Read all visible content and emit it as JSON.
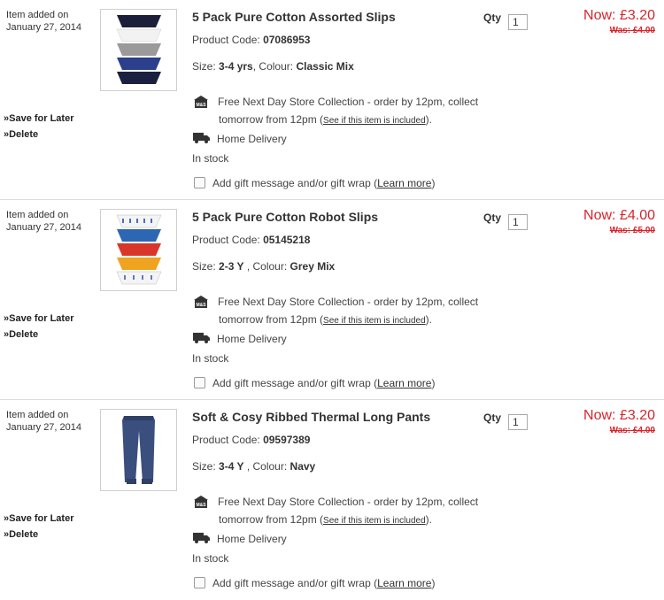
{
  "colors": {
    "price_red": "#d8232a",
    "separator": "#dcdcdc"
  },
  "items": [
    {
      "added_label": "Item added on",
      "added_date": "January 27, 2014",
      "save_label": "»Save for Later",
      "delete_label": "»Delete",
      "title": "5 Pack Pure Cotton Assorted Slips",
      "code_label": "Product Code:",
      "code": "07086953",
      "size_label": "Size:",
      "size": "3-4 yrs",
      "colour_label": ", Colour:",
      "colour": "Classic Mix",
      "collect_text1": "Free Next Day Store Collection - order by 12pm, collect",
      "collect_text2": "tomorrow from 12pm (",
      "collect_link": "See if this item is included",
      "collect_text3": ").",
      "delivery": "Home Delivery",
      "stock": "In stock",
      "gift_text": "Add gift message and/or gift wrap (",
      "gift_link": "Learn more",
      "gift_close": ")",
      "qty_label": "Qty",
      "qty": "1",
      "now_label": "Now:",
      "now_price": "£3.20",
      "was": "Was: £4.00",
      "image_icon": "slips-navy-image"
    },
    {
      "added_label": "Item added on",
      "added_date": "January 27, 2014",
      "save_label": "»Save for Later",
      "delete_label": "»Delete",
      "title": "5 Pack Pure Cotton Robot Slips",
      "code_label": "Product Code:",
      "code": "05145218",
      "size_label": "Size:",
      "size": "2-3 Y",
      "colour_label": " , Colour:",
      "colour": "Grey Mix",
      "collect_text1": "Free Next Day Store Collection - order by 12pm, collect",
      "collect_text2": "tomorrow from 12pm (",
      "collect_link": "See if this item is included",
      "collect_text3": ").",
      "delivery": "Home Delivery",
      "stock": "In stock",
      "gift_text": "Add gift message and/or gift wrap (",
      "gift_link": "Learn more",
      "gift_close": ")",
      "qty_label": "Qty",
      "qty": "1",
      "now_label": "Now:",
      "now_price": "£4.00",
      "was": "Was: £5.00",
      "image_icon": "slips-robot-image"
    },
    {
      "added_label": "Item added on",
      "added_date": "January 27, 2014",
      "save_label": "»Save for Later",
      "delete_label": "»Delete",
      "title": "Soft & Cosy Ribbed Thermal Long Pants",
      "code_label": "Product Code:",
      "code": "09597389",
      "size_label": "Size:",
      "size": "3-4 Y",
      "colour_label": " , Colour:",
      "colour": "Navy",
      "collect_text1": "Free Next Day Store Collection - order by 12pm, collect",
      "collect_text2": "tomorrow from 12pm (",
      "collect_link": "See if this item is included",
      "collect_text3": ").",
      "delivery": "Home Delivery",
      "stock": "In stock",
      "gift_text": "Add gift message and/or gift wrap (",
      "gift_link": "Learn more",
      "gift_close": ")",
      "qty_label": "Qty",
      "qty": "1",
      "now_label": "Now:",
      "now_price": "£3.20",
      "was": "Was: £4.00",
      "image_icon": "thermal-pants-image"
    }
  ]
}
